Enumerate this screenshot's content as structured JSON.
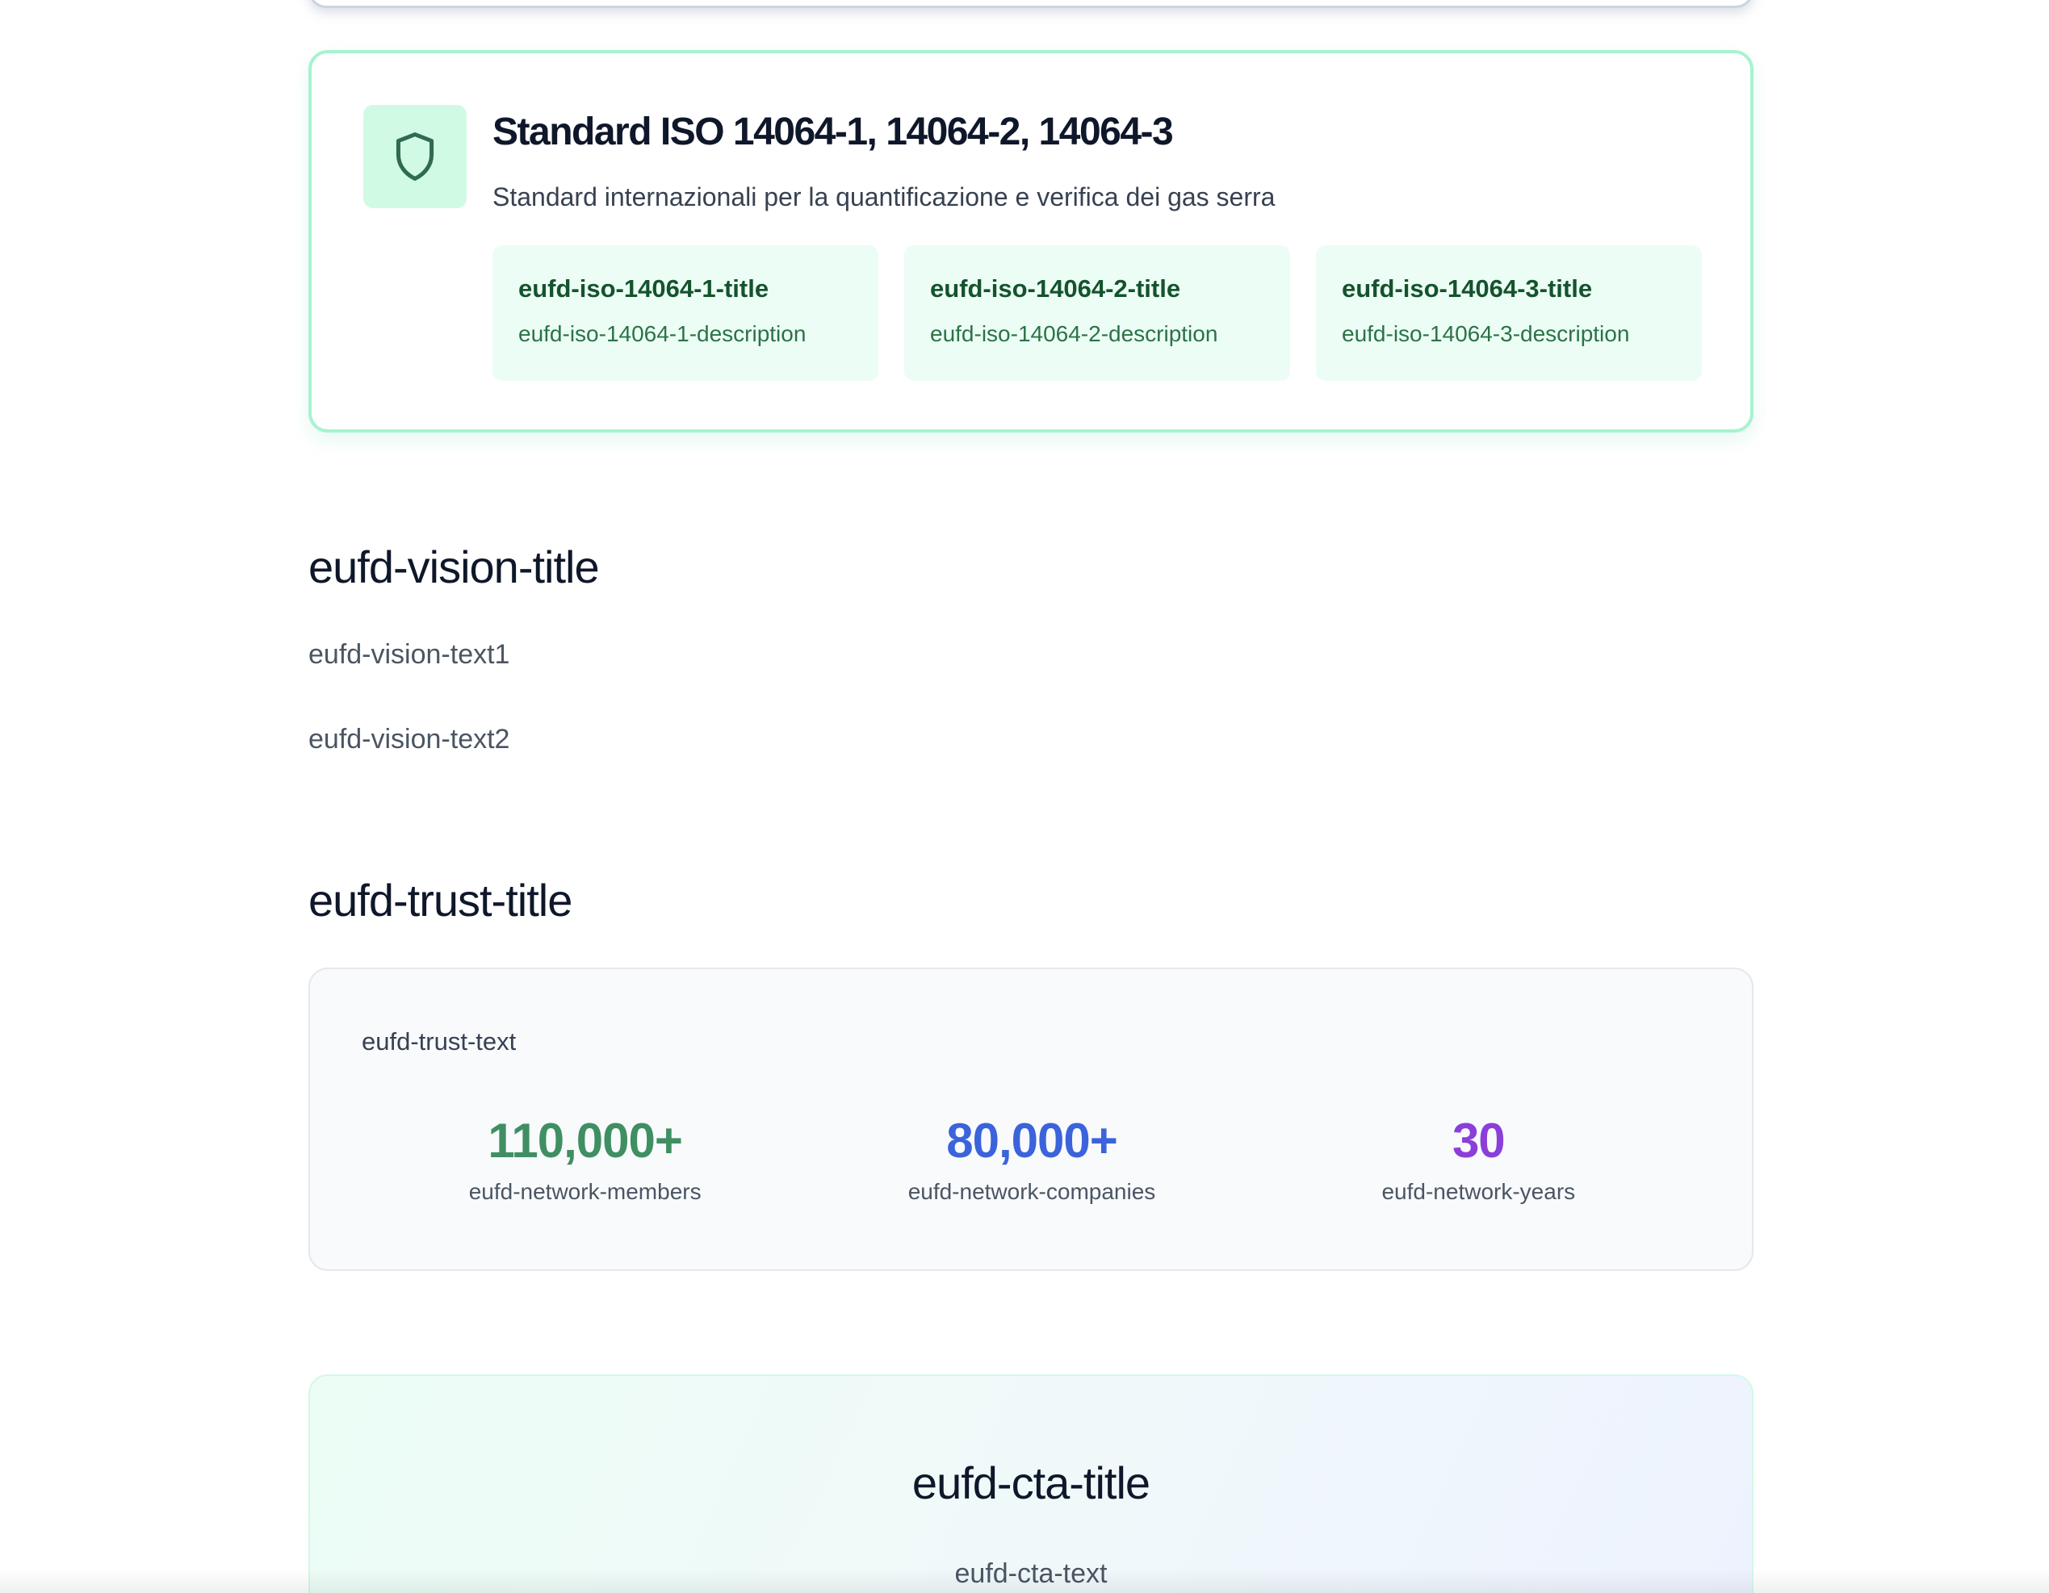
{
  "iso": {
    "title": "Standard ISO 14064-1, 14064-2, 14064-3",
    "subtitle": "Standard internazionali per la quantificazione e verifica dei gas serra",
    "icon": "shield-icon",
    "items": [
      {
        "title": "eufd-iso-14064-1-title",
        "description": "eufd-iso-14064-1-description"
      },
      {
        "title": "eufd-iso-14064-2-title",
        "description": "eufd-iso-14064-2-description"
      },
      {
        "title": "eufd-iso-14064-3-title",
        "description": "eufd-iso-14064-3-description"
      }
    ]
  },
  "vision": {
    "title": "eufd-vision-title",
    "text1": "eufd-vision-text1",
    "text2": "eufd-vision-text2"
  },
  "trust": {
    "title": "eufd-trust-title",
    "text": "eufd-trust-text",
    "stats": [
      {
        "value": "110,000+",
        "label": "eufd-network-members",
        "color": "#3f8f63"
      },
      {
        "value": "80,000+",
        "label": "eufd-network-companies",
        "color": "#3b63db"
      },
      {
        "value": "30",
        "label": "eufd-network-years",
        "color": "#8b3fd9"
      }
    ]
  },
  "cta": {
    "title": "eufd-cta-title",
    "text": "eufd-cta-text"
  },
  "colors": {
    "accent_green": "#10b981",
    "icon_green": "#2f6b4f"
  }
}
